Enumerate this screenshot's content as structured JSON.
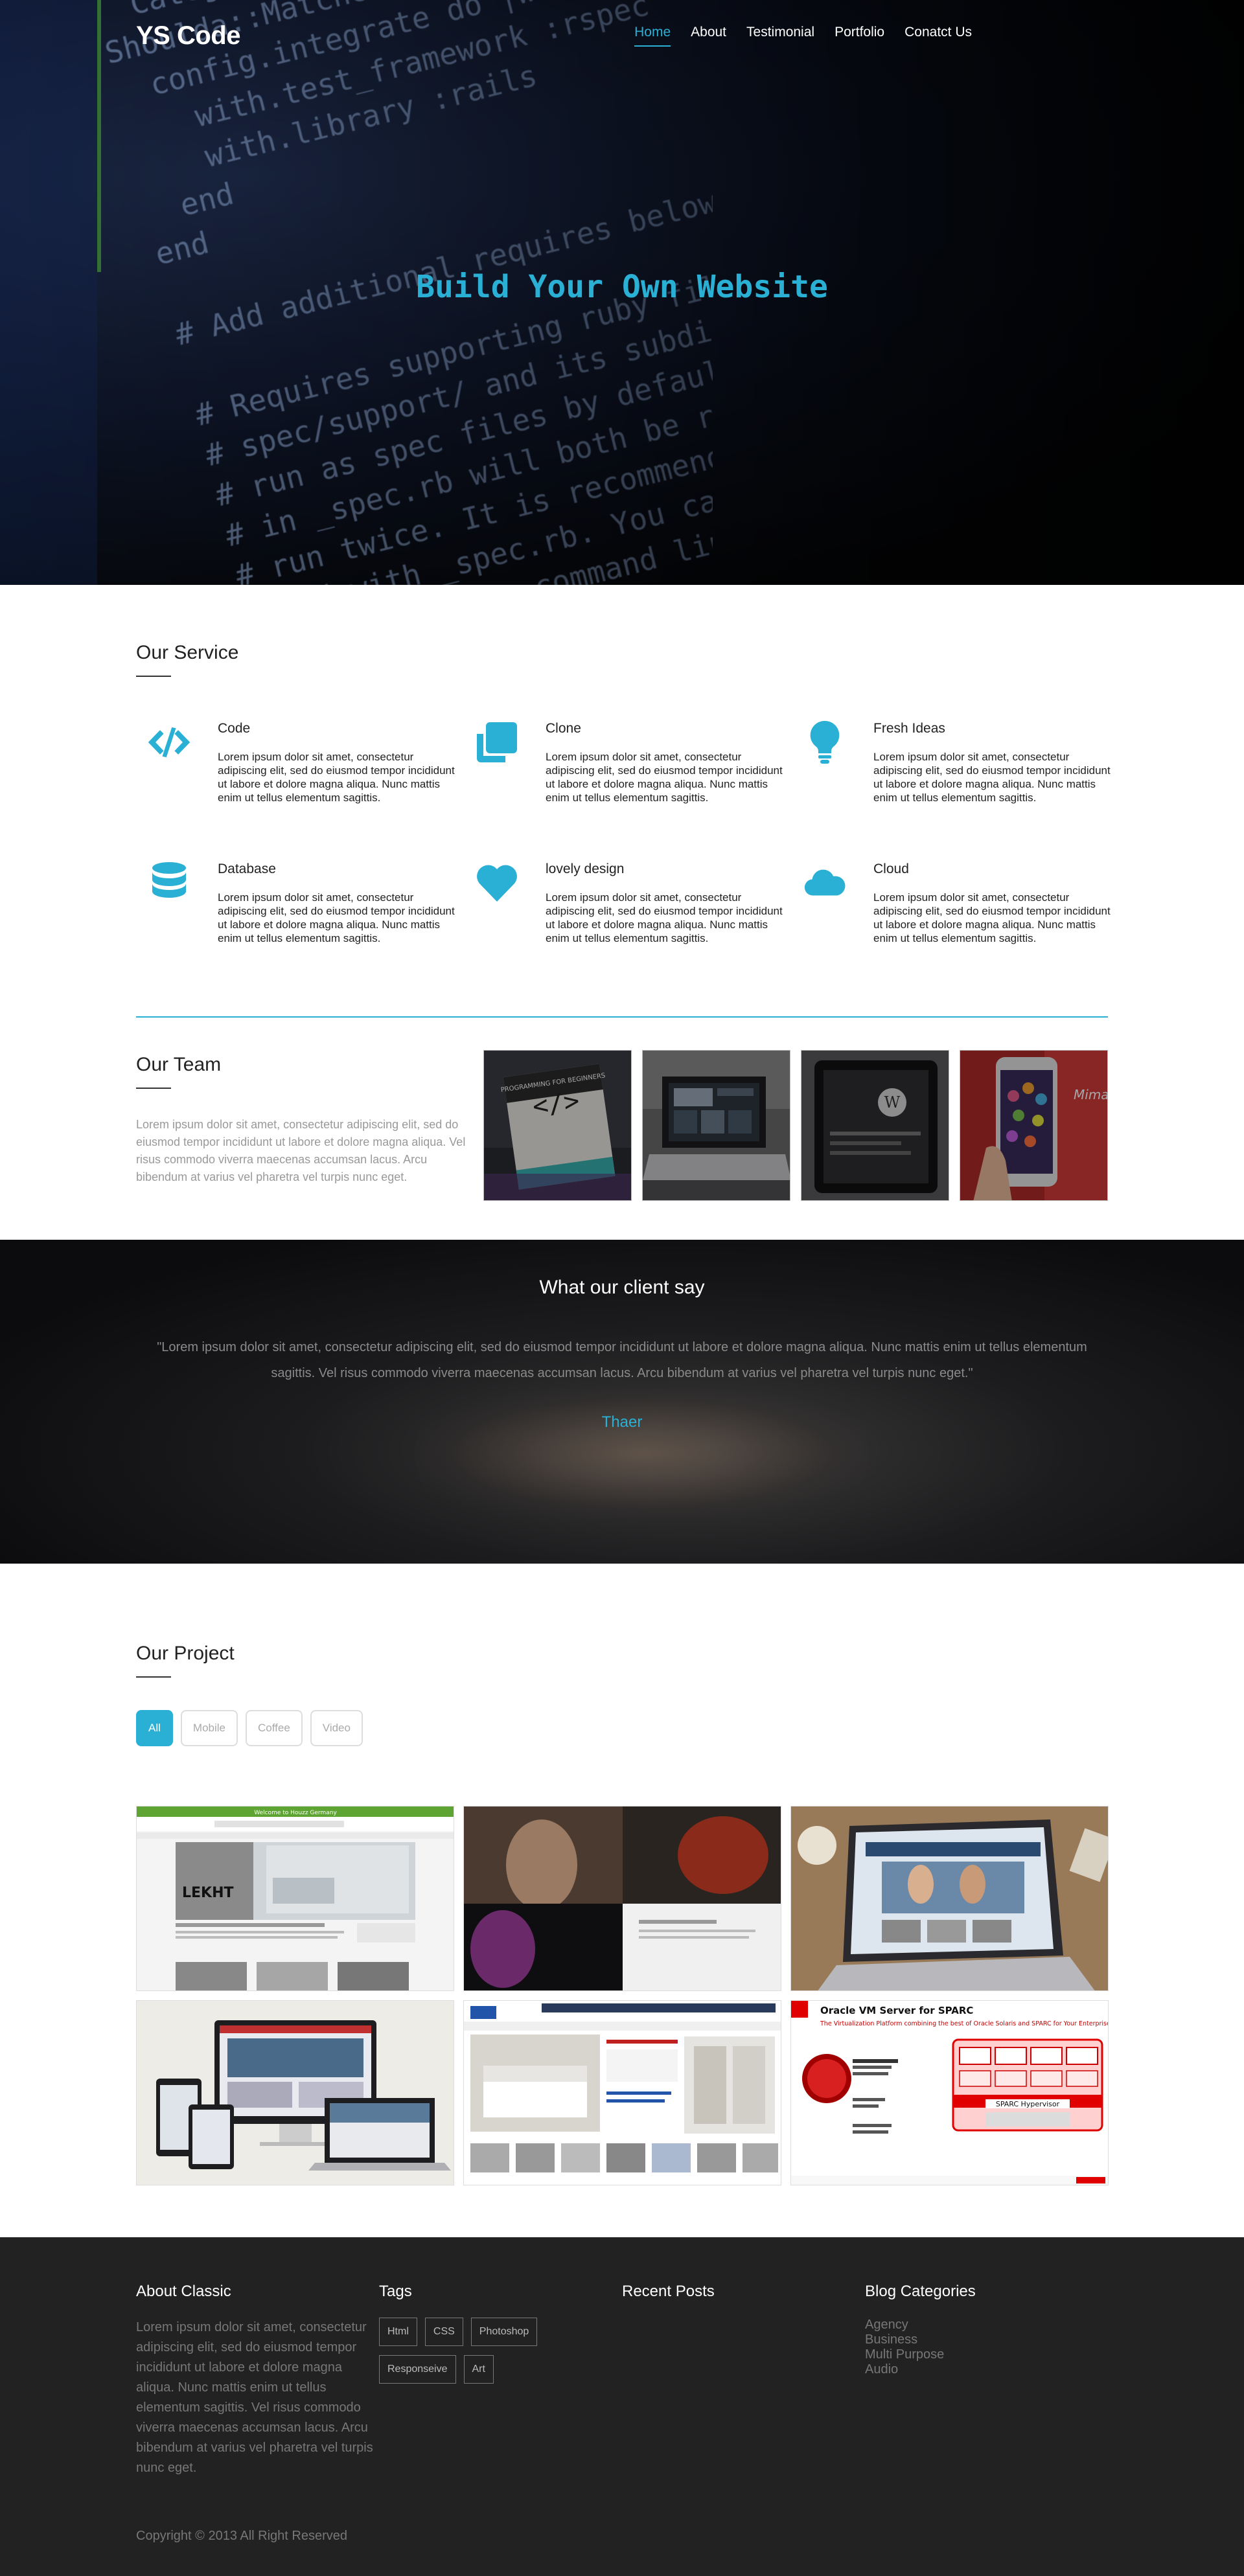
{
  "brand": "YS Code",
  "nav": {
    "items": [
      "Home",
      "About",
      "Testimonial",
      "Portfolio",
      "Conatct Us"
    ],
    "active_index": 0
  },
  "hero": {
    "title": "Build Your Own Website",
    "code_lines": [
      "  Category.all.each do",
      "Shoulda::Matchers.configure do |config|",
      "  config.integrate do |with|",
      "    with.test_framework :rspec",
      "    with.library :rails",
      "  end",
      "end",
      "",
      "# Add additional requires below this line",
      "",
      "# Requires supporting ruby files with custom",
      "# spec/support/ and its subdirectories",
      "# run as spec files by default. This m",
      "# in _spec.rb will both be required",
      "# run twice. It is recommended that",
      "# end with _spec.rb. You can config",
      "# option on the command line"
    ]
  },
  "services": {
    "title": "Our Service",
    "items": [
      {
        "icon": "code-icon",
        "title": "Code",
        "text": "Lorem ipsum dolor sit amet, consectetur adipiscing elit, sed do eiusmod tempor incididunt ut labore et dolore magna aliqua. Nunc mattis enim ut tellus elementum sagittis."
      },
      {
        "icon": "clone-icon",
        "title": "Clone",
        "text": "Lorem ipsum dolor sit amet, consectetur adipiscing elit, sed do eiusmod tempor incididunt ut labore et dolore magna aliqua. Nunc mattis enim ut tellus elementum sagittis."
      },
      {
        "icon": "lightbulb-icon",
        "title": "Fresh Ideas",
        "text": "Lorem ipsum dolor sit amet, consectetur adipiscing elit, sed do eiusmod tempor incididunt ut labore et dolore magna aliqua. Nunc mattis enim ut tellus elementum sagittis."
      },
      {
        "icon": "database-icon",
        "title": "Database",
        "text": "Lorem ipsum dolor sit amet, consectetur adipiscing elit, sed do eiusmod tempor incididunt ut labore et dolore magna aliqua. Nunc mattis enim ut tellus elementum sagittis."
      },
      {
        "icon": "heart-icon",
        "title": "lovely design",
        "text": "Lorem ipsum dolor sit amet, consectetur adipiscing elit, sed do eiusmod tempor incididunt ut labore et dolore magna aliqua. Nunc mattis enim ut tellus elementum sagittis."
      },
      {
        "icon": "cloud-icon",
        "title": "Cloud",
        "text": "Lorem ipsum dolor sit amet, consectetur adipiscing elit, sed do eiusmod tempor incididunt ut labore et dolore magna aliqua. Nunc mattis enim ut tellus elementum sagittis."
      }
    ]
  },
  "team": {
    "title": "Our Team",
    "text": "Lorem ipsum dolor sit amet, consectetur adipiscing elit, sed do eiusmod tempor incididunt ut labore et dolore magna aliqua. Vel risus commodo viverra maecenas accumsan lacus. Arcu bibendum at varius vel pharetra vel turpis nunc eget.",
    "book_title": "PROGRAMMING FOR BEGINNERS",
    "brand_label": "Mimaki"
  },
  "testimonial": {
    "title": "What our client say",
    "quote": "\"Lorem ipsum dolor sit amet, consectetur adipiscing elit, sed do eiusmod tempor incididunt ut labore et dolore magna aliqua. Nunc mattis enim ut tellus elementum sagittis. Vel risus commodo viverra maecenas accumsan lacus. Arcu bibendum at varius vel pharetra vel turpis nunc eget.\"",
    "author": "Thaer"
  },
  "projects": {
    "title": "Our Project",
    "filters": [
      "All",
      "Mobile",
      "Coffee",
      "Video"
    ],
    "active_filter": 0,
    "thumb_texts": {
      "houzz_header": "Welcome to Houzz Germany",
      "houzz_brand": "LEKHT",
      "sparc_title": "Oracle VM Server for SPARC",
      "sparc_subtitle": "The Virtualization Platform combining the best of Oracle Solaris and SPARC for Your Enterprise Server Workloads",
      "sparc_hypervisor": "SPARC Hypervisor"
    }
  },
  "footer": {
    "about_title": "About Classic",
    "about_text": "Lorem ipsum dolor sit amet, consectetur adipiscing elit, sed do eiusmod tempor incididunt ut labore et dolore magna aliqua. Nunc mattis enim ut tellus elementum sagittis. Vel risus commodo viverra maecenas accumsan lacus. Arcu bibendum at varius vel pharetra vel turpis nunc eget.",
    "tags_title": "Tags",
    "tags": [
      "Html",
      "CSS",
      "Photoshop",
      "Responseive",
      "Art"
    ],
    "posts_title": "Recent Posts",
    "categories_title": "Blog Categories",
    "categories": [
      "Agency",
      "Business",
      "Multi Purpose",
      "Audio"
    ],
    "copyright": "Copyright © 2013 All Right Reserved"
  },
  "colors": {
    "accent": "#2ab0d5",
    "footer_bg": "#222222",
    "text_dark": "#222222",
    "text_muted": "#999999"
  }
}
